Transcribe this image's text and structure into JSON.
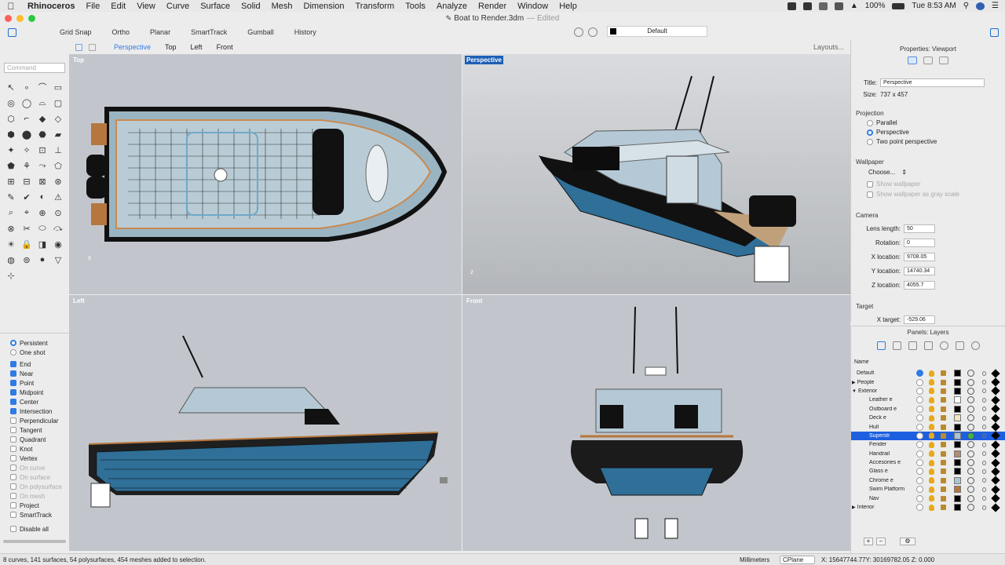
{
  "menubar": {
    "app": "Rhinoceros",
    "items": [
      "File",
      "Edit",
      "View",
      "Curve",
      "Surface",
      "Solid",
      "Mesh",
      "Dimension",
      "Transform",
      "Tools",
      "Analyze",
      "Render",
      "Window",
      "Help"
    ],
    "battery": "100%",
    "clock": "Tue 8:53 AM"
  },
  "window": {
    "title": "Boat to Render.3dm",
    "edited": "— Edited"
  },
  "toolbar": {
    "buttons": [
      "Grid Snap",
      "Ortho",
      "Planar",
      "SmartTrack",
      "Gumball",
      "History"
    ],
    "current_layer": "Default"
  },
  "command": {
    "placeholder": "Command"
  },
  "viewport_tabs": {
    "tabs": [
      "Perspective",
      "Top",
      "Left",
      "Front"
    ],
    "active": "Perspective",
    "layouts": "Layouts..."
  },
  "viewports": {
    "top": "Top",
    "perspective": "Perspective",
    "left": "Left",
    "front": "Front"
  },
  "osnaps": {
    "persistent": "Persistent",
    "one_shot": "One shot",
    "items": [
      {
        "label": "End",
        "checked": true
      },
      {
        "label": "Near",
        "checked": true
      },
      {
        "label": "Point",
        "checked": true
      },
      {
        "label": "Midpoint",
        "checked": true
      },
      {
        "label": "Center",
        "checked": true
      },
      {
        "label": "Intersection",
        "checked": true
      },
      {
        "label": "Perpendicular",
        "checked": false
      },
      {
        "label": "Tangent",
        "checked": false
      },
      {
        "label": "Quadrant",
        "checked": false
      },
      {
        "label": "Knot",
        "checked": false
      },
      {
        "label": "Vertex",
        "checked": false
      },
      {
        "label": "On curve",
        "checked": false,
        "disabled": true
      },
      {
        "label": "On surface",
        "checked": false,
        "disabled": true
      },
      {
        "label": "On polysurface",
        "checked": false,
        "disabled": true
      },
      {
        "label": "On mesh",
        "checked": false,
        "disabled": true
      },
      {
        "label": "Project",
        "checked": false
      },
      {
        "label": "SmartTrack",
        "checked": false
      }
    ],
    "disable_all": "Disable all"
  },
  "properties": {
    "header": "Properties: Viewport",
    "title_label": "Title:",
    "title_value": "Perspective",
    "size_label": "Size:",
    "size_value": "737 x 457",
    "projection": "Projection",
    "parallel": "Parallel",
    "perspective": "Perspective",
    "two_point": "Two point perspective",
    "wallpaper": "Wallpaper",
    "choose": "Choose...",
    "show_wallpaper": "Show wallpaper",
    "show_gray": "Show wallpaper as gray scale",
    "camera": "Camera",
    "lens_label": "Lens length:",
    "lens": "50",
    "rotation_label": "Rotation:",
    "rotation": "0",
    "xloc_label": "X location:",
    "xloc": "9708.05",
    "yloc_label": "Y location:",
    "yloc": "14740.34",
    "zloc_label": "Z location:",
    "zloc": "4055.7",
    "target": "Target",
    "xtarget_label": "X target:",
    "xtarget": "-529.06"
  },
  "layers": {
    "header": "Panels: Layers",
    "col_name": "Name",
    "rows": [
      {
        "name": "Default",
        "indent": 0,
        "current": true,
        "color": "#000000"
      },
      {
        "name": "People",
        "indent": 0,
        "expand": "▶",
        "color": "#000000"
      },
      {
        "name": "Exterior",
        "indent": 0,
        "expand": "▼",
        "color": "#000000"
      },
      {
        "name": "Leather e",
        "indent": 1,
        "color": "#ffffff"
      },
      {
        "name": "Outboard e",
        "indent": 1,
        "color": "#000000"
      },
      {
        "name": "Deck e",
        "indent": 1,
        "color": "#f3e6c4"
      },
      {
        "name": "Hull",
        "indent": 1,
        "color": "#000000"
      },
      {
        "name": "Superstr",
        "indent": 1,
        "selected": true,
        "color": "#a9c4d3"
      },
      {
        "name": "Fender",
        "indent": 1,
        "color": "#000000"
      },
      {
        "name": "Handrail",
        "indent": 1,
        "color": "#b08c74"
      },
      {
        "name": "Accesories e",
        "indent": 1,
        "color": "#000000"
      },
      {
        "name": "Glass e",
        "indent": 1,
        "color": "#000000"
      },
      {
        "name": "Chrome e",
        "indent": 1,
        "color": "#a9c4d3"
      },
      {
        "name": "Swim Platform",
        "indent": 1,
        "color": "#b5773e"
      },
      {
        "name": "Nav",
        "indent": 1,
        "color": "#000000"
      },
      {
        "name": "Interior",
        "indent": 0,
        "expand": "▶",
        "color": "#000000"
      }
    ]
  },
  "status": {
    "message": "8 curves, 141 surfaces, 54 polysurfaces, 454 meshes added to selection.",
    "units": "Millimeters",
    "cplane": "CPlane",
    "coords": "X: 15647744.77Y: 30169782.05 Z: 0.000"
  }
}
